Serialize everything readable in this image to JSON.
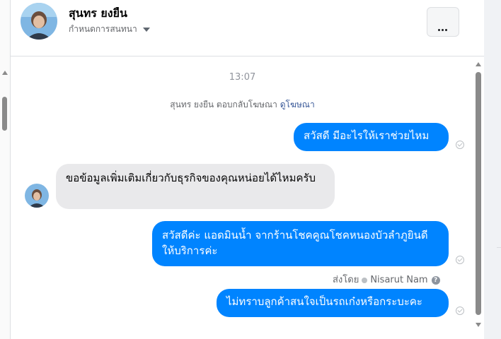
{
  "header": {
    "name": "สุนทร ยงยืน",
    "manage_label": "กำหนดการสนทนา",
    "more_button_icon": "more-horizontal-icon"
  },
  "chat": {
    "timestamp": "13:07",
    "replied_notice": {
      "text": "สุนทร ยงยืน ตอบกลับโฆษณา",
      "link": "ดูโฆษณา"
    },
    "messages": [
      {
        "direction": "outgoing",
        "text": "สวัสดี มีอะไรให้เราช่วยไหม"
      },
      {
        "direction": "incoming",
        "text": "ขอข้อมูลเพิ่มเติมเกี่ยวกับธุรกิจของคุณหน่อยได้ไหมครับ"
      },
      {
        "direction": "outgoing",
        "text": "สวัสดีค่ะ แอดมินน้ำ จากร้านโชคคูณโชคหนองบัวลำภูยินดีให้บริการค่ะ"
      },
      {
        "direction": "outgoing",
        "text": "ไม่ทราบลูกค้าสนใจเป็นรถเก๋งหรือกระบะคะ"
      }
    ],
    "sent_by": {
      "prefix": "ส่งโดย",
      "agent": "Nisarut Nam",
      "help": "?"
    }
  },
  "colors": {
    "outgoing_bubble": "#0084ff",
    "incoming_bubble": "#e9e9eb",
    "link": "#385898"
  }
}
